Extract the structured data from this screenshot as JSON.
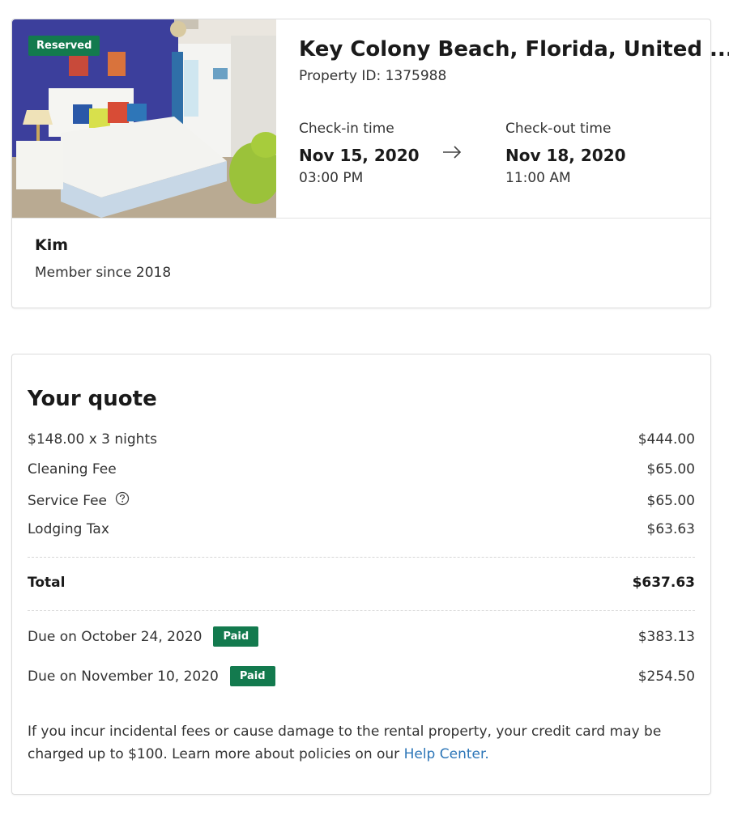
{
  "booking": {
    "badge": "Reserved",
    "title": "Key Colony Beach, Florida, United ...",
    "property_id": "Property ID: 1375988",
    "checkin": {
      "label": "Check-in time",
      "date": "Nov 15, 2020",
      "time": "03:00 PM"
    },
    "checkout": {
      "label": "Check-out time",
      "date": "Nov 18, 2020",
      "time": "11:00 AM"
    },
    "guest": {
      "name": "Kim",
      "since": "Member since 2018"
    }
  },
  "quote": {
    "title": "Your quote",
    "lines": [
      {
        "label": "$148.00 x 3 nights",
        "amount": "$444.00"
      },
      {
        "label": "Cleaning Fee",
        "amount": "$65.00"
      },
      {
        "label": "Service Fee",
        "amount": "$65.00"
      },
      {
        "label": "Lodging Tax",
        "amount": "$63.63"
      }
    ],
    "total": {
      "label": "Total",
      "amount": "$637.63"
    },
    "payments": [
      {
        "label": "Due on October 24, 2020",
        "status": "Paid",
        "amount": "$383.13"
      },
      {
        "label": "Due on November 10, 2020",
        "status": "Paid",
        "amount": "$254.50"
      }
    ],
    "policy_text": "If you incur incidental fees or cause damage to the rental property, your credit card may be charged up to $100. Learn more about policies on our ",
    "help_link": "Help Center."
  },
  "colors": {
    "accent_green": "#137a4e",
    "link_blue": "#2d76b8"
  },
  "icons": {
    "arrow": "arrow-right-icon",
    "help": "question-circle-icon"
  }
}
